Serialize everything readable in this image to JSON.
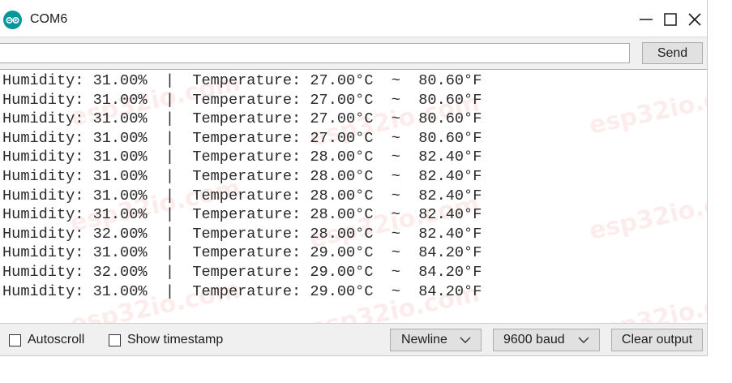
{
  "window": {
    "title": "COM6",
    "icons": {
      "logo": "arduino-logo-icon",
      "minimize": "minimize-icon",
      "maximize": "maximize-icon",
      "close": "close-icon"
    }
  },
  "input_row": {
    "value": "",
    "placeholder": "",
    "send_label": "Send"
  },
  "output": {
    "lines": [
      "Humidity: 31.00%  |  Temperature: 27.00°C  ~  80.60°F",
      "Humidity: 31.00%  |  Temperature: 27.00°C  ~  80.60°F",
      "Humidity: 31.00%  |  Temperature: 27.00°C  ~  80.60°F",
      "Humidity: 31.00%  |  Temperature: 27.00°C  ~  80.60°F",
      "Humidity: 31.00%  |  Temperature: 28.00°C  ~  82.40°F",
      "Humidity: 31.00%  |  Temperature: 28.00°C  ~  82.40°F",
      "Humidity: 31.00%  |  Temperature: 28.00°C  ~  82.40°F",
      "Humidity: 31.00%  |  Temperature: 28.00°C  ~  82.40°F",
      "Humidity: 32.00%  |  Temperature: 28.00°C  ~  82.40°F",
      "Humidity: 31.00%  |  Temperature: 29.00°C  ~  84.20°F",
      "Humidity: 32.00%  |  Temperature: 29.00°C  ~  84.20°F",
      "Humidity: 31.00%  |  Temperature: 29.00°C  ~  84.20°F"
    ],
    "watermark": "esp32io.com"
  },
  "status_bar": {
    "autoscroll_label": "Autoscroll",
    "autoscroll_checked": false,
    "timestamp_label": "Show timestamp",
    "timestamp_checked": false,
    "line_ending": "Newline",
    "baud_rate": "9600 baud",
    "clear_label": "Clear output"
  },
  "colors": {
    "logo": "#00979c",
    "panel_background": "#f0f0f0",
    "button_background": "#e1e1e1",
    "watermark": "#eb6e6e"
  }
}
